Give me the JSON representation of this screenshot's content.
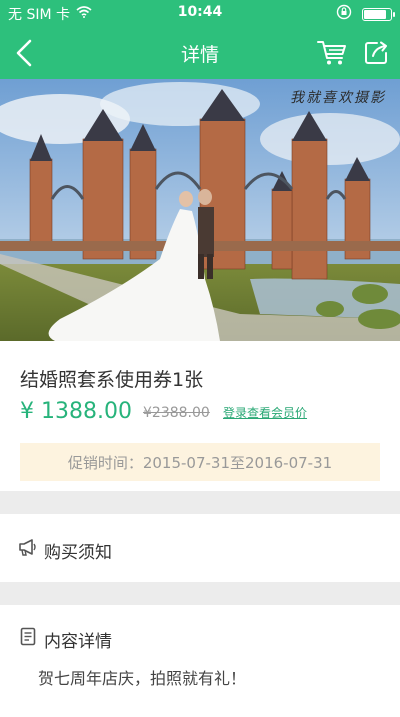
{
  "status_bar": {
    "carrier": "无 SIM 卡",
    "time": "10:44"
  },
  "nav": {
    "title": "详情"
  },
  "hero": {
    "watermark": "我就喜欢摄影"
  },
  "product": {
    "name": "结婚照套系使用券1张",
    "price": "¥ 1388.00",
    "original_price": "¥2388.00",
    "member_link": "登录查看会员价",
    "promo": "促销时间：2015-07-31至2016-07-31"
  },
  "notice": {
    "label": "购买须知"
  },
  "details": {
    "label": "内容详情",
    "text": "贺七周年店庆，拍照就有礼！"
  },
  "colors": {
    "brand": "#2dc07c",
    "price": "#27b37b",
    "promo_bg": "#fdf3df"
  },
  "icons": [
    "wifi-icon",
    "rotation-lock-icon",
    "battery-icon",
    "back-arrow-icon",
    "cart-icon",
    "share-icon",
    "megaphone-icon",
    "document-icon"
  ]
}
